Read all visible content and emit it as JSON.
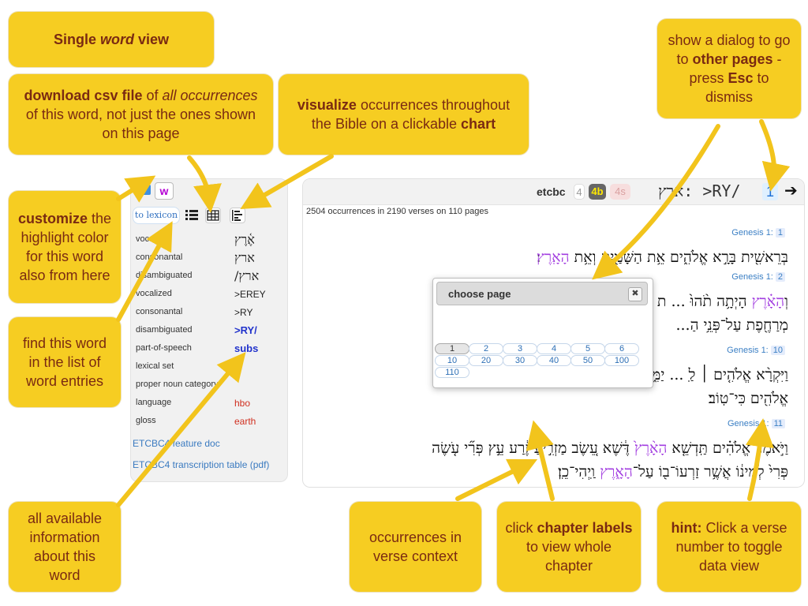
{
  "callouts": {
    "single_word": {
      "pre": "Single ",
      "em": "word",
      "post": " view"
    },
    "download": {
      "b1": "download csv file",
      "t1": " of ",
      "i1": "all occurrences",
      "t2": " of this word, not just the ones shown on this page"
    },
    "visualize": {
      "b1": "visualize",
      "t1": " occurrences throughout the Bible on a clickable ",
      "b2": "chart"
    },
    "dialog": {
      "t1": "show a dialog to go to ",
      "b1": "other pages",
      "t2": " - press ",
      "b2": "Esc",
      "t3": " to dismiss"
    },
    "customize": {
      "b1": "customize",
      "t1": " the highlight color for this word also from here"
    },
    "find": "find this word in the list of word entries",
    "allinfo": "all available information about this word",
    "occurrences": "occurrences in verse context",
    "chapter": {
      "t1": "click ",
      "b1": "chapter labels",
      "t2": " to view whole chapter"
    },
    "hint": {
      "b1": "hint:",
      "t1": " Click a verse number to toggle data view"
    }
  },
  "sidebar": {
    "w_label": "w",
    "lexicon_label": "to lexicon",
    "features": [
      {
        "name": "vocalized",
        "value": "אֶ֫רֶץ",
        "style": "heb"
      },
      {
        "name": "consonantal",
        "value": "ארץ",
        "style": "heb"
      },
      {
        "name": "disambiguated",
        "value": "ארץ/",
        "style": "heb"
      },
      {
        "name": "vocalized",
        "value": ">EREY",
        "style": "plain"
      },
      {
        "name": "consonantal",
        "value": ">RY",
        "style": "plain"
      },
      {
        "name": "disambiguated",
        "value": ">RY/",
        "style": "blue"
      },
      {
        "name": "part-of-speech",
        "value": "subs",
        "style": "blue"
      },
      {
        "name": "lexical set",
        "value": "",
        "style": "plain"
      },
      {
        "name": "proper noun category",
        "value": "",
        "style": "plain"
      },
      {
        "name": "language",
        "value": "hbo",
        "style": "red"
      },
      {
        "name": "gloss",
        "value": "earth",
        "style": "red"
      }
    ],
    "link_feature_doc": "ETCBC4 feature doc",
    "link_transcription": "ETCBC4 transcription table (pdf)"
  },
  "main": {
    "corpus": "etcbc",
    "versions": [
      "4",
      "4b",
      "4s"
    ],
    "word_title": "ארץ: >RY/",
    "page_number": "1",
    "next_icon": "➔",
    "occurrence_info": "2504 occurrences in 2190 verses on 110 pages",
    "verses": [
      {
        "book": "Genesis 1:",
        "num": "1",
        "lines": [
          [
            "בְּרֵאשִׁ֖ית בָּרָ֣א אֱלֹהִ֑ים אֵ֥ת הַשָּׁמַ֖יִם וְאֵ֥ת ",
            {
              "hl": "הָאָֽרֶץ"
            },
            "׃"
          ]
        ]
      },
      {
        "book": "Genesis 1:",
        "num": "2",
        "lines": [
          [
            "וְ",
            {
              "hl": "הָאָ֗רֶץ"
            },
            " הָיְתָ֥ה תֹ֨הוּ֙ ... ת אֱלֹהִ֔ים"
          ],
          [
            "מְרַחֶ֖פֶת עַל־פְּנֵ֥י הַ..."
          ]
        ]
      },
      {
        "book": "Genesis 1:",
        "num": "10",
        "lines": [
          [
            "וַיִּקְרָ֨א אֱלֹהִ֤ים ׀ לַֽ ... יַמִּ֑ים וַיַּ֥רְא"
          ],
          [
            "אֱלֹהִ֖ים כִּי־טֽוֹב׃"
          ]
        ]
      },
      {
        "book": "Genesis 1:",
        "num": "11",
        "lines": [
          [
            "וַיֹּ֣אמֶר אֱלֹהִ֗ים תַּֽדְשֵׁ֤א ",
            {
              "hl": "הָאָ֨רֶץ֙"
            },
            " דֶּ֔שֶׁא עֵ֚שֶׂב מַזְרִ֣יעַ זֶ֔רַע עֵ֣ץ פְּרִ֞י עֹ֤שֶׂה"
          ],
          [
            "פְּרִי֙ לְמִינ֔וֹ אֲשֶׁ֥ר זַרְעוֹ־ב֖וֹ עַל־",
            {
              "hl": "הָאָ֑רֶץ"
            },
            " וַֽיְהִי־כֵֽן׃"
          ]
        ]
      }
    ]
  },
  "dialog": {
    "title": "choose page",
    "close_icon": "✖",
    "pages": [
      "1",
      "2",
      "3",
      "4",
      "5",
      "6",
      "10",
      "20",
      "30",
      "40",
      "50",
      "100",
      "110"
    ],
    "current_page": "1"
  },
  "colors": {
    "callout": "#f6cd22",
    "callout_text": "#7a2a12",
    "highlight": "#a23ee0",
    "link": "#3b7fc4"
  }
}
